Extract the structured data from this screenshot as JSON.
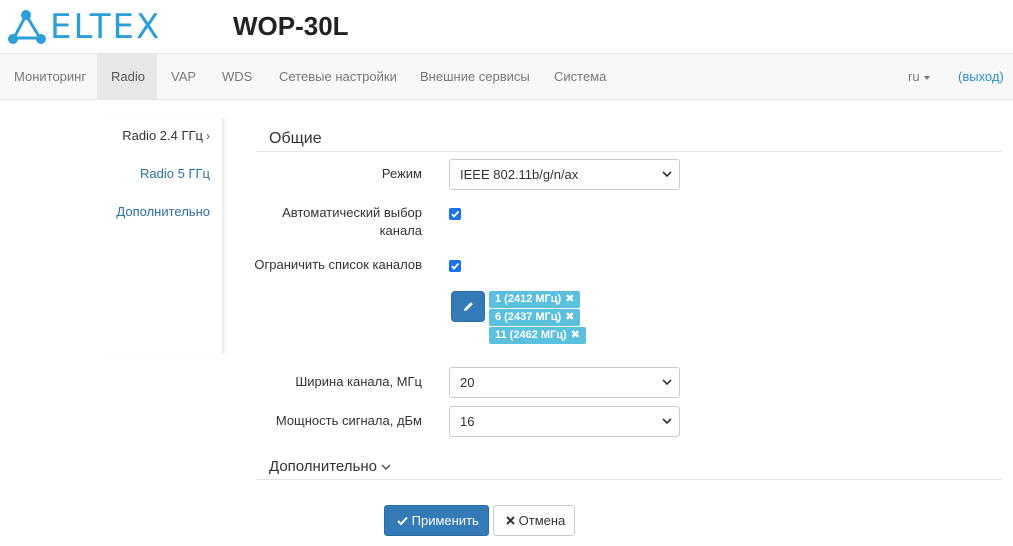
{
  "header": {
    "logo_text": "ELTEX",
    "model": "WOP-30L"
  },
  "navbar": {
    "items": [
      "Мониторинг",
      "Radio",
      "VAP",
      "WDS",
      "Сетевые настройки",
      "Внешние сервисы",
      "Система"
    ],
    "active_item": "Radio",
    "language": "ru",
    "logout": "(выход)"
  },
  "sidebar": {
    "items": [
      "Radio 2.4 ГГц",
      "Radio 5 ГГц",
      "Дополнительно"
    ],
    "active_item": "Radio 2.4 ГГц"
  },
  "form": {
    "section_title": "Общие",
    "mode": {
      "label": "Режим",
      "value": "IEEE 802.11b/g/n/ax"
    },
    "auto_channel": {
      "label": "Автоматический выбор канала",
      "checked": true
    },
    "limit_channels": {
      "label": "Ограничить список каналов",
      "checked": true
    },
    "channels": [
      "1 (2412 МГц)",
      "6 (2437 МГц)",
      "11 (2462 МГц)"
    ],
    "channel_width": {
      "label": "Ширина канала, МГц",
      "value": "20"
    },
    "tx_power": {
      "label": "Мощность сигнала, дБм",
      "value": "16"
    },
    "advanced_section": "Дополнительно"
  },
  "buttons": {
    "apply": "Применить",
    "cancel": "Отмена"
  },
  "colors": {
    "brand": "#2b9fd9",
    "primary": "#337ab7",
    "tag": "#5bc0de",
    "link": "#2a6fa8"
  },
  "icons": [
    "eltex-logo-icon",
    "pencil-icon",
    "check-icon",
    "times-icon",
    "chevron-right-icon",
    "chevron-down-icon",
    "caret-down-icon"
  ]
}
